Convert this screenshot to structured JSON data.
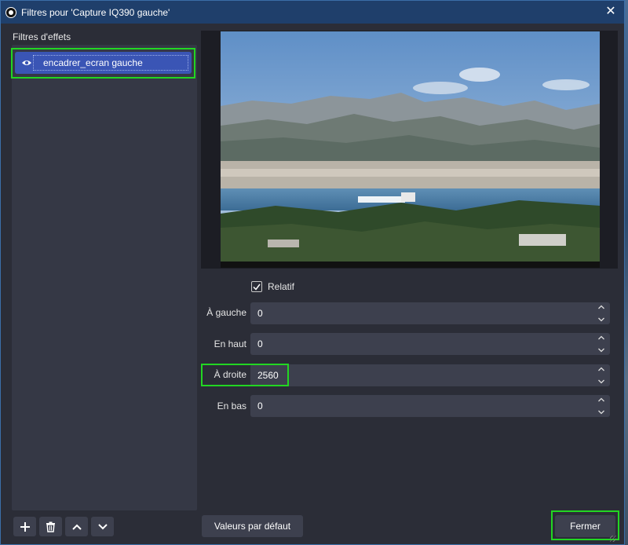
{
  "window": {
    "title": "Filtres pour 'Capture IQ390 gauche'",
    "close_glyph": "✕"
  },
  "filters": {
    "section_label": "Filtres d'effets",
    "items": [
      {
        "name": "encadrer_ecran gauche",
        "visible": true,
        "icon": "eye-icon"
      }
    ]
  },
  "toolbar": {
    "add_icon": "plus-icon",
    "remove_icon": "trash-icon",
    "up_icon": "chevron-up-icon",
    "down_icon": "chevron-down-icon"
  },
  "preview": {
    "description_icon": "landscape-preview"
  },
  "properties": {
    "relatif_label": "Relatif",
    "relatif_checked": true,
    "fields": [
      {
        "label": "À gauche",
        "value": "0"
      },
      {
        "label": "En haut",
        "value": "0"
      },
      {
        "label": "À droite",
        "value": "2560"
      },
      {
        "label": "En bas",
        "value": "0"
      }
    ]
  },
  "footer": {
    "defaults_label": "Valeurs par défaut",
    "close_label": "Fermer"
  },
  "colors": {
    "accent_highlight": "#22d622",
    "selection": "#3a55b5",
    "titlebar": "#1f3f6b"
  }
}
